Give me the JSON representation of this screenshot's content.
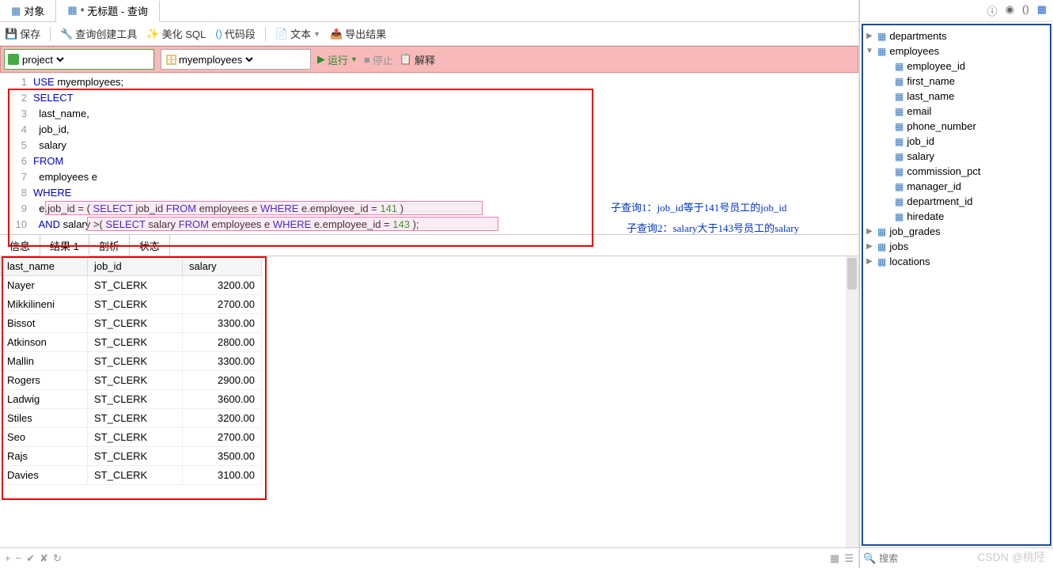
{
  "tabs": {
    "object": "对象",
    "query": "* 无标题 - 查询"
  },
  "toolbar": {
    "save": "保存",
    "queryBuilder": "查询创建工具",
    "beautify": "美化 SQL",
    "codeSnippet": "代码段",
    "text": "文本",
    "export": "导出结果"
  },
  "runbar": {
    "project": "project",
    "database": "myemployees",
    "run": "运行",
    "stop": "停止",
    "explain": "解释"
  },
  "code": {
    "lineNumbers": [
      "1",
      "2",
      "3",
      "4",
      "5",
      "6",
      "7",
      "8",
      "9",
      "10"
    ],
    "l1_kw": "USE",
    "l1_rest": " myemployees;",
    "l2_kw": "SELECT",
    "l3": "  last_name,",
    "l4": "  job_id,",
    "l5": "  salary",
    "l6_kw": "FROM",
    "l7": "  employees e ",
    "l8_kw": "WHERE",
    "l9_a": "  e.job_id = ( ",
    "l9_kw1": "SELECT",
    "l9_b": " job_id ",
    "l9_kw2": "FROM",
    "l9_c": " employees e ",
    "l9_kw3": "WHERE",
    "l9_d": " e.employee_id = ",
    "l9_num": "141",
    "l9_e": " )",
    "l10_pad": "  ",
    "l10_kw0": "AND",
    "l10_a": " salary >( ",
    "l10_kw1": "SELECT",
    "l10_b": " salary ",
    "l10_kw2": "FROM",
    "l10_c": " employees e ",
    "l10_kw3": "WHERE",
    "l10_d": " e.employee_id = ",
    "l10_num": "143",
    "l10_e": " );"
  },
  "annotations": {
    "q1": "子查询1：job_id等于141号员工的job_id",
    "q2": "子查询2：salary大于143号员工的salary"
  },
  "resultTabs": {
    "info": "信息",
    "result": "结果 1",
    "profile": "剖析",
    "status": "状态"
  },
  "columns": [
    "last_name",
    "job_id",
    "salary"
  ],
  "rows": [
    {
      "last_name": "Nayer",
      "job_id": "ST_CLERK",
      "salary": "3200.00"
    },
    {
      "last_name": "Mikkilineni",
      "job_id": "ST_CLERK",
      "salary": "2700.00"
    },
    {
      "last_name": "Bissot",
      "job_id": "ST_CLERK",
      "salary": "3300.00"
    },
    {
      "last_name": "Atkinson",
      "job_id": "ST_CLERK",
      "salary": "2800.00"
    },
    {
      "last_name": "Mallin",
      "job_id": "ST_CLERK",
      "salary": "3300.00"
    },
    {
      "last_name": "Rogers",
      "job_id": "ST_CLERK",
      "salary": "2900.00"
    },
    {
      "last_name": "Ladwig",
      "job_id": "ST_CLERK",
      "salary": "3600.00"
    },
    {
      "last_name": "Stiles",
      "job_id": "ST_CLERK",
      "salary": "3200.00"
    },
    {
      "last_name": "Seo",
      "job_id": "ST_CLERK",
      "salary": "2700.00"
    },
    {
      "last_name": "Rajs",
      "job_id": "ST_CLERK",
      "salary": "3500.00"
    },
    {
      "last_name": "Davies",
      "job_id": "ST_CLERK",
      "salary": "3100.00"
    }
  ],
  "tree": {
    "departments": "departments",
    "employees": "employees",
    "employeesCols": [
      "employee_id",
      "first_name",
      "last_name",
      "email",
      "phone_number",
      "job_id",
      "salary",
      "commission_pct",
      "manager_id",
      "department_id",
      "hiredate"
    ],
    "job_grades": "job_grades",
    "jobs": "jobs",
    "locations": "locations"
  },
  "search": {
    "placeholder": "搜索"
  },
  "watermark": "CSDN @桃陉"
}
